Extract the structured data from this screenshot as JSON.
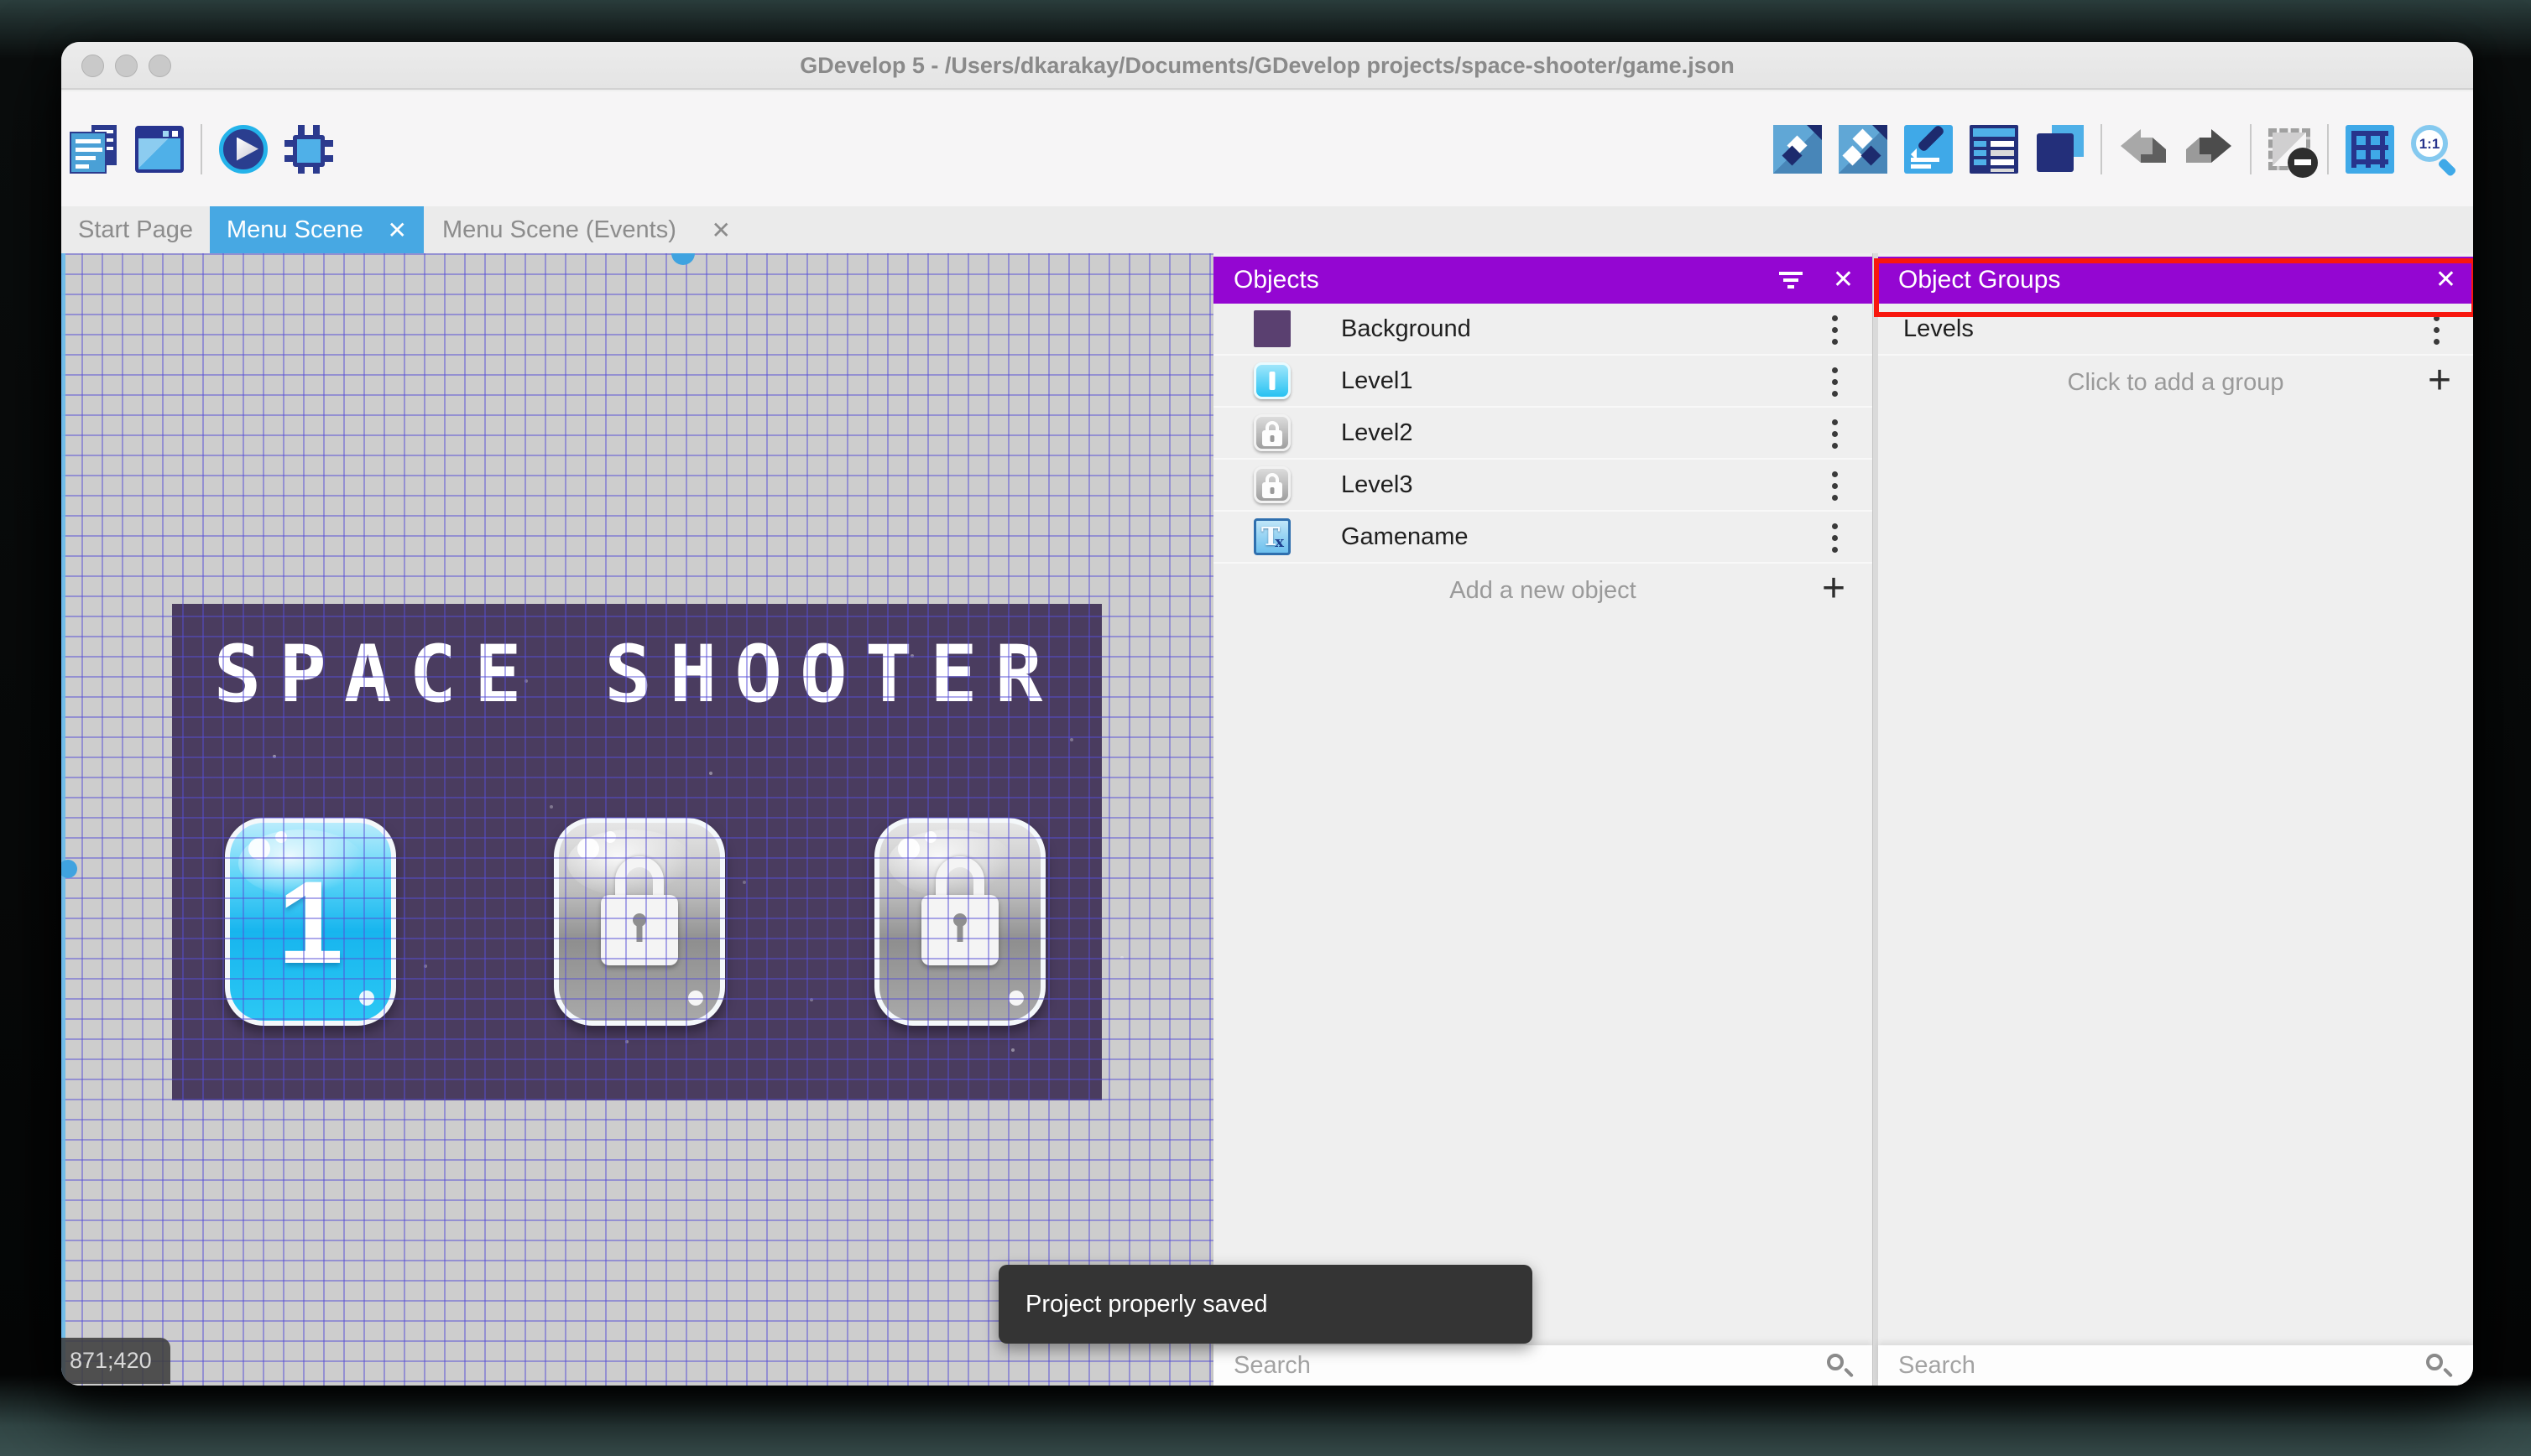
{
  "window": {
    "title": "GDevelop 5 - /Users/dkarakay/Documents/GDevelop projects/space-shooter/game.json"
  },
  "icons": {
    "close": "✕",
    "plus": "+",
    "zoom_ratio": "1:1"
  },
  "toolbar": {
    "left": [
      "project-manager",
      "scene-editor-window",
      "play",
      "debugger"
    ],
    "right": [
      "object",
      "objects-group",
      "edit-scene-properties",
      "layers-list",
      "instances",
      "undo",
      "redo",
      "mask",
      "grid",
      "zoom-1-1"
    ]
  },
  "tabs": [
    {
      "label": "Start Page",
      "active": false,
      "closable": false
    },
    {
      "label": "Menu Scene",
      "active": true,
      "closable": true
    },
    {
      "label": "Menu Scene (Events)",
      "active": false,
      "closable": true
    }
  ],
  "canvas": {
    "scene_title": "SPACE SHOOTER",
    "level_button_label": "1",
    "locked_buttons_count": 2,
    "coordinates": "871;420"
  },
  "objects_panel": {
    "title": "Objects",
    "items": [
      {
        "label": "Background",
        "icon": "background-thumbnail"
      },
      {
        "label": "Level1",
        "icon": "level1-button-thumbnail"
      },
      {
        "label": "Level2",
        "icon": "locked-button-thumbnail"
      },
      {
        "label": "Level3",
        "icon": "locked-button-thumbnail"
      },
      {
        "label": "Gamename",
        "icon": "text-object-thumbnail"
      }
    ],
    "add_label": "Add a new object",
    "search_placeholder": "Search"
  },
  "groups_panel": {
    "title": "Object Groups",
    "items": [
      {
        "label": "Levels"
      }
    ],
    "add_label": "Click to add a group",
    "search_placeholder": "Search"
  },
  "toast": {
    "message": "Project properly saved"
  },
  "colors": {
    "panel_header_purple": "#9406d2",
    "active_tab_blue": "#47a8e3",
    "annotation_red": "#f8170e",
    "scene_purple": "#4a3c5f",
    "scrollbar_blue": "#41a4de",
    "canvas_grey": "#cdcdcd"
  }
}
